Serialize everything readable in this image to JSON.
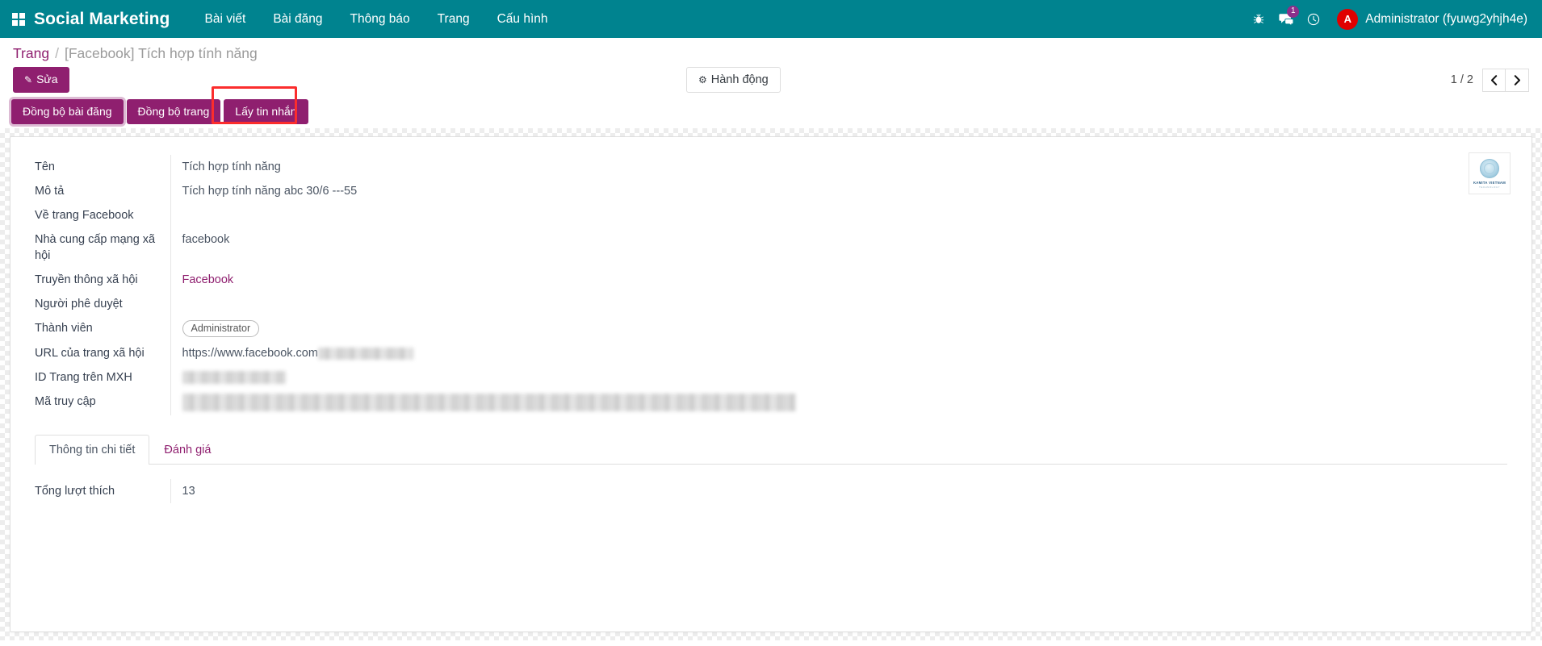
{
  "navbar": {
    "apps_icon": "apps-grid-icon",
    "brand": "Social Marketing",
    "menu": [
      {
        "label": "Bài viết"
      },
      {
        "label": "Bài đăng"
      },
      {
        "label": "Thông báo"
      },
      {
        "label": "Trang"
      },
      {
        "label": "Cấu hình"
      }
    ],
    "sys_icons": [
      {
        "name": "debug-bug-icon",
        "glyph": "🐞"
      },
      {
        "name": "messages-icon",
        "glyph": "💬",
        "badge": "1"
      },
      {
        "name": "activities-clock-icon",
        "glyph": "◷"
      }
    ],
    "user": {
      "avatar_initial": "A",
      "name": "Administrator (fyuwg2yhjh4e)",
      "avatar_color": "#e00000"
    }
  },
  "control_panel": {
    "breadcrumb": {
      "root": "Trang",
      "separator": "/",
      "current": "[Facebook] Tích hợp tính năng"
    },
    "edit_button": {
      "label": "Sửa",
      "icon": "pencil-icon",
      "glyph": "✎"
    },
    "action_button": {
      "label": "Hành động",
      "icon": "gear-icon",
      "glyph": "⚙"
    },
    "pager": {
      "label": "1 / 2",
      "prev_glyph": "‹",
      "next_glyph": "›"
    }
  },
  "object_buttons": [
    {
      "label": "Đồng bộ bài đăng",
      "state": "focused"
    },
    {
      "label": "Đồng bộ trang",
      "state": "normal"
    },
    {
      "label": "Lấy tin nhắn",
      "state": "highlighted"
    }
  ],
  "highlight": {
    "color": "#fb2d2d"
  },
  "sheet": {
    "logo": {
      "title": "KAMITA VIETNAM",
      "subtitle": "TECHNOLOGY"
    },
    "fields": [
      {
        "label": "Tên",
        "value": "Tích hợp tính năng",
        "type": "text"
      },
      {
        "label": "Mô tả",
        "value": "Tích hợp tính năng abc 30/6 ---55",
        "type": "text"
      },
      {
        "label": "Về trang Facebook",
        "value": "",
        "type": "text"
      },
      {
        "label": "Nhà cung cấp mạng xã hội",
        "value": "facebook",
        "type": "text"
      },
      {
        "label": "Truyền thông xã hội",
        "value": "Facebook",
        "type": "link"
      },
      {
        "label": "Người phê duyệt",
        "value": "",
        "type": "text"
      },
      {
        "label": "Thành viên",
        "value": "Administrator",
        "type": "tag"
      },
      {
        "label": "URL của trang xã hội",
        "value": "https://www.facebook.com",
        "type": "text-redacted",
        "redact_width": 118
      },
      {
        "label": "ID Trang trên MXH",
        "value": "",
        "type": "redacted",
        "redact_width": 128
      },
      {
        "label": "Mã truy cập",
        "value": "",
        "type": "redacted",
        "redact_width": 760
      }
    ],
    "notebook": {
      "tabs": [
        {
          "label": "Thông tin chi tiết",
          "active": true
        },
        {
          "label": "Đánh giá",
          "active": false
        }
      ],
      "page_fields": [
        {
          "label": "Tổng lượt thích",
          "value": "13"
        }
      ]
    }
  },
  "colors": {
    "navbar_teal": "#00838f",
    "brand_purple": "#8f1f6f",
    "highlight_red": "#fb2d2d"
  }
}
